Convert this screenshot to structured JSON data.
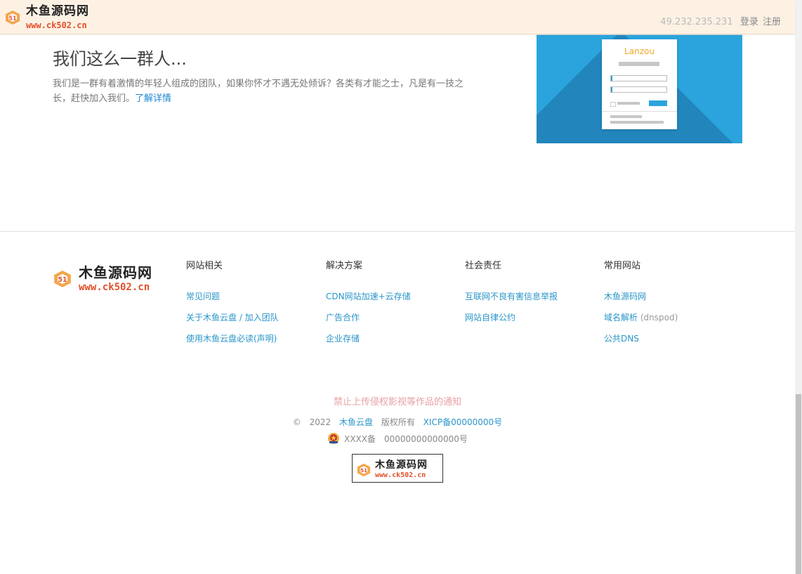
{
  "header": {
    "logo": {
      "name": "木鱼源码网",
      "url": "www.ck502.cn"
    },
    "ip": "49.232.235.231",
    "login": "登录",
    "register": "注册"
  },
  "hero": {
    "title": "我们这么一群人...",
    "desc": "我们是一群有着激情的年轻人组成的团队，如果你怀才不遇无处倾诉？各类有才能之士，凡是有一技之长，赶快加入我们。",
    "link": "了解详情"
  },
  "illustration": {
    "brand": "Lanzou",
    "dots": [
      "#a8cfe8",
      "#f6a3a8",
      "#f9d48f",
      "#a9d9a8",
      "#c7c1ba"
    ]
  },
  "footer": {
    "logo": {
      "name": "木鱼源码网",
      "url": "www.ck502.cn"
    },
    "columns": [
      {
        "title": "网站相关",
        "links": [
          "常见问题",
          "关于木鱼云盘 / 加入团队",
          "使用木鱼云盘必读(声明)"
        ]
      },
      {
        "title": "解决方案",
        "links": [
          "CDN网站加速+云存储",
          "广告合作",
          "企业存储"
        ]
      },
      {
        "title": "社会责任",
        "links": [
          "互联网不良有害信息举报",
          "网站自律公约"
        ]
      },
      {
        "title": "常用网站",
        "links": [
          "木鱼源码网",
          "域名解析",
          "公共DNS"
        ],
        "aside": "(dnspod)"
      }
    ],
    "notice": "禁止上传侵权影视等作品的通知",
    "copyright": {
      "symbol": "©",
      "year": "2022",
      "site": "木鱼云盘",
      "rights": "版权所有",
      "icp": "XICP备00000000号"
    },
    "police": {
      "label": "XXXX备",
      "number": "00000000000000号"
    },
    "bottom_logo": {
      "name": "木鱼源码网",
      "url": "www.ck502.cn"
    }
  },
  "colors": {
    "accent": "#2a95c9",
    "link": "#1e88d2",
    "notice": "#e8a0a0",
    "topbar": "#fdf1e4",
    "illustration": "#2ba4dd"
  }
}
